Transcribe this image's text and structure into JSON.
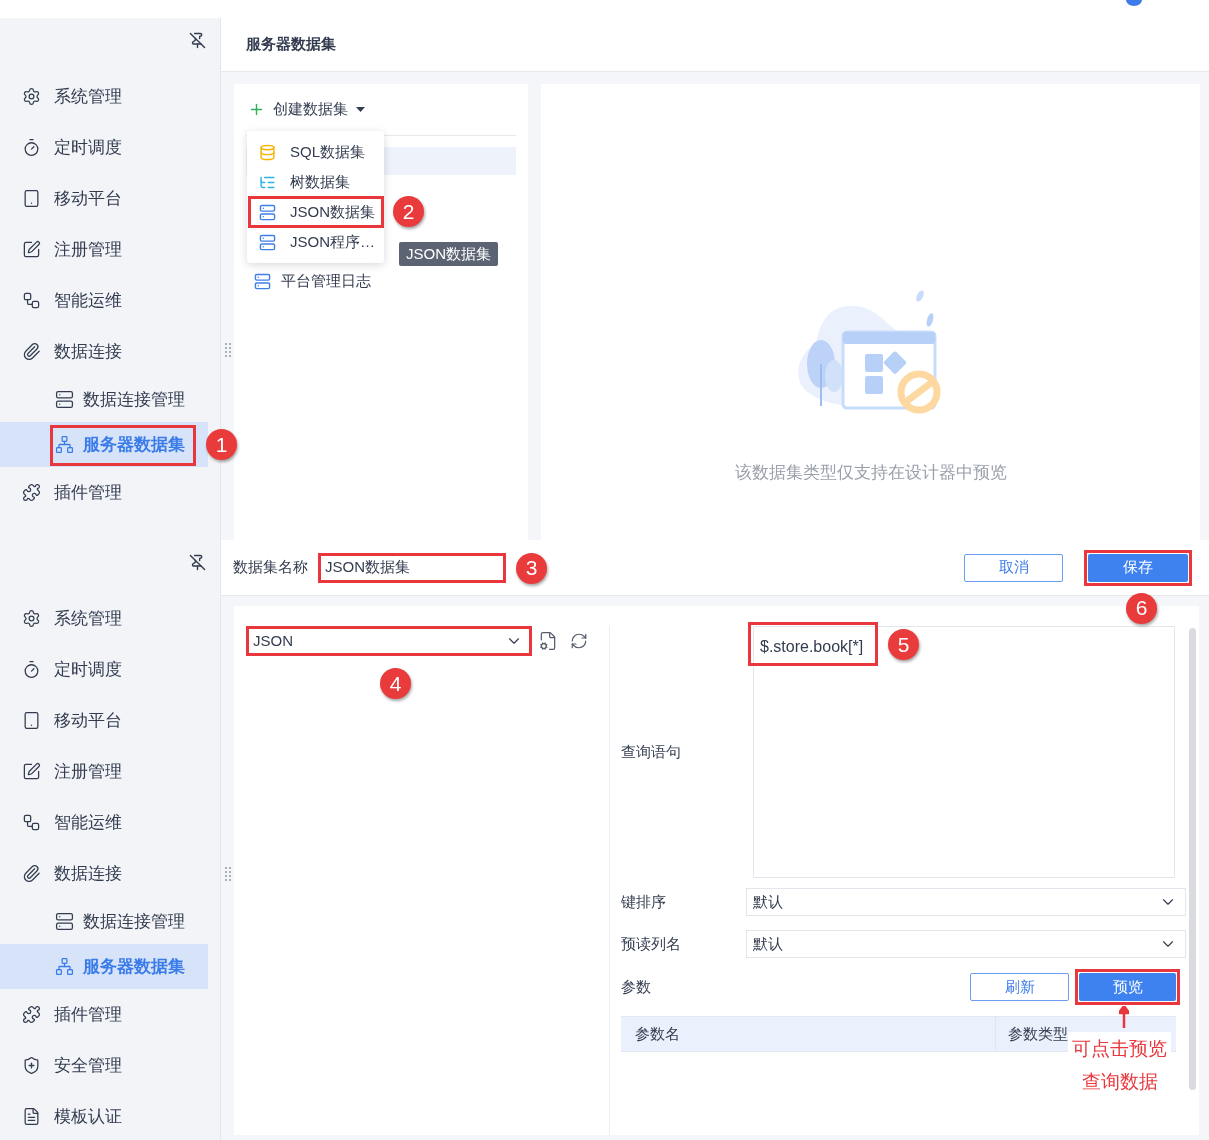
{
  "top_screen": {
    "sidebar": {
      "items": [
        {
          "label": "系统管理",
          "selected": false
        },
        {
          "label": "定时调度",
          "selected": false
        },
        {
          "label": "移动平台",
          "selected": false
        },
        {
          "label": "注册管理",
          "selected": false
        },
        {
          "label": "智能运维",
          "selected": false
        },
        {
          "label": "数据连接",
          "selected": false,
          "children": [
            {
              "label": "数据连接管理",
              "selected": false
            },
            {
              "label": "服务器数据集",
              "selected": true,
              "highlighted": true,
              "callout": "1"
            }
          ]
        },
        {
          "label": "插件管理",
          "selected": false
        }
      ]
    },
    "header": {
      "title": "服务器数据集"
    },
    "create_button": {
      "label": "创建数据集"
    },
    "menu": {
      "items": [
        {
          "label": "SQL数据集",
          "kind": "sql"
        },
        {
          "label": "树数据集",
          "kind": "tree"
        },
        {
          "label": "JSON数据集",
          "kind": "json",
          "highlighted": true,
          "callout": "2"
        },
        {
          "label": "JSON程序…",
          "kind": "json"
        }
      ]
    },
    "tooltip": "JSON数据集",
    "dataset_list": {
      "items": [
        {
          "label": "平台管理日志",
          "kind": "json"
        }
      ]
    },
    "preview_message": "该数据集类型仅支持在设计器中预览"
  },
  "bottom_screen": {
    "sidebar": {
      "items": [
        {
          "label": "系统管理",
          "selected": false
        },
        {
          "label": "定时调度",
          "selected": false
        },
        {
          "label": "移动平台",
          "selected": false
        },
        {
          "label": "注册管理",
          "selected": false
        },
        {
          "label": "智能运维",
          "selected": false
        },
        {
          "label": "数据连接",
          "selected": false,
          "children": [
            {
              "label": "数据连接管理",
              "selected": false
            },
            {
              "label": "服务器数据集",
              "selected": true
            }
          ]
        },
        {
          "label": "插件管理",
          "selected": false
        },
        {
          "label": "安全管理",
          "selected": false
        },
        {
          "label": "模板认证",
          "selected": false
        }
      ]
    },
    "name_field": {
      "label": "数据集名称",
      "value": "JSON数据集",
      "highlighted": true,
      "callout": "3"
    },
    "cancel_button": {
      "label": "取消"
    },
    "save_button": {
      "label": "保存",
      "highlighted": true,
      "callout": "6"
    },
    "source_select": {
      "value": "JSON",
      "highlighted": true,
      "callout": "4"
    },
    "query": {
      "label": "查询语句",
      "value": "$.store.book[*]",
      "highlighted": true,
      "callout": "5"
    },
    "key_sort": {
      "label": "键排序",
      "value": "默认"
    },
    "preread_columns": {
      "label": "预读列名",
      "value": "默认"
    },
    "params": {
      "label": "参数",
      "refresh_button": {
        "label": "刷新"
      },
      "preview_button": {
        "label": "预览",
        "highlighted": true
      }
    },
    "params_table": {
      "columns": [
        "参数名",
        "参数类型"
      ]
    },
    "note": [
      "可点击预览",
      "查询数据"
    ]
  }
}
